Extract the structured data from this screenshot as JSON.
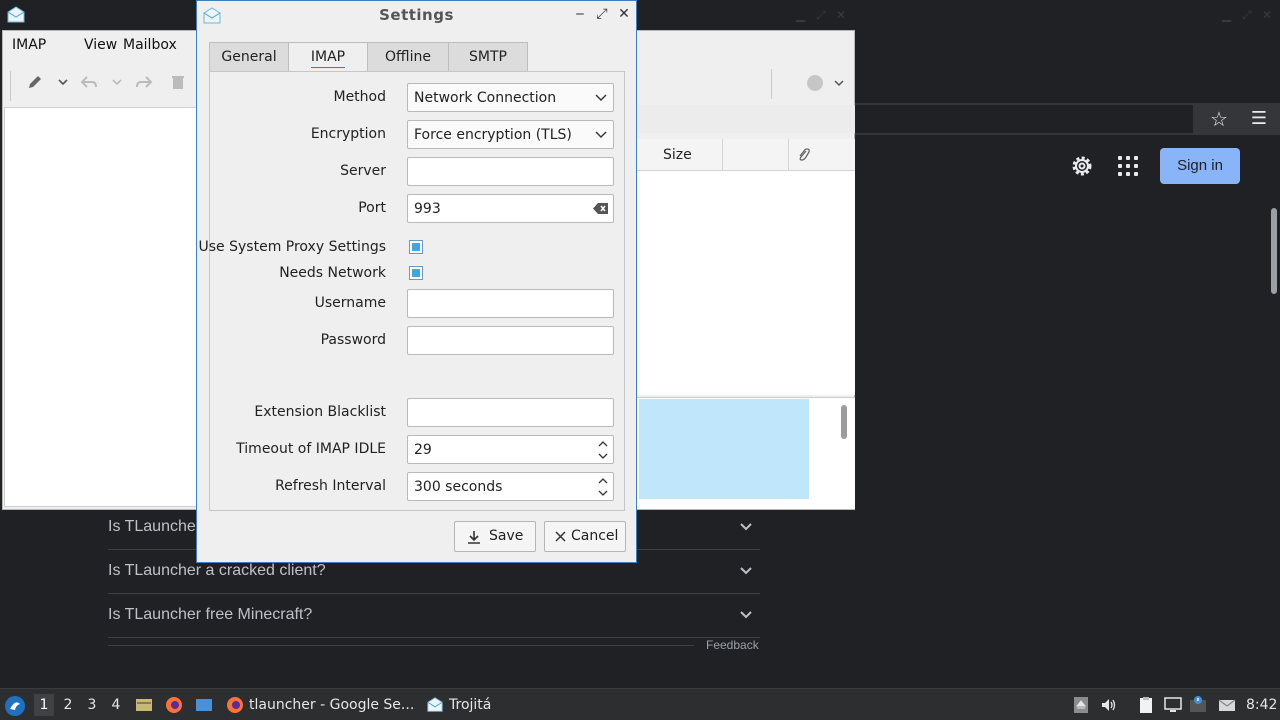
{
  "desktop": {
    "faq": [
      {
        "question": "Is TLauncher"
      },
      {
        "question": "Is TLauncher a cracked client?"
      },
      {
        "question": "Is TLauncher free Minecraft?"
      }
    ],
    "feedback_label": "Feedback",
    "signin_label": "Sign in"
  },
  "mail_window": {
    "menu": [
      "IMAP",
      "View",
      "Mailbox"
    ],
    "columns": {
      "size": "Size"
    }
  },
  "dialog": {
    "title": "Settings",
    "tabs": [
      {
        "label": "General"
      },
      {
        "label": "IMAP"
      },
      {
        "label": "Offline"
      },
      {
        "label": "SMTP"
      }
    ],
    "active_tab": "IMAP",
    "fields": {
      "method": {
        "label": "Method",
        "value": "Network Connection"
      },
      "encryption": {
        "label": "Encryption",
        "value": "Force encryption (TLS)"
      },
      "server": {
        "label": "Server",
        "value": ""
      },
      "port": {
        "label": "Port",
        "value": "993"
      },
      "proxy": {
        "label": "Use System Proxy Settings",
        "checked": true
      },
      "needs_network": {
        "label": "Needs Network",
        "checked": true
      },
      "username": {
        "label": "Username",
        "value": ""
      },
      "password": {
        "label": "Password",
        "value": ""
      },
      "extension_blacklist": {
        "label": "Extension Blacklist",
        "value": ""
      },
      "timeout": {
        "label": "Timeout of IMAP IDLE",
        "value": "29"
      },
      "refresh": {
        "label": "Refresh Interval",
        "value": "300 seconds"
      }
    },
    "buttons": {
      "save": "Save",
      "cancel": "Cancel"
    }
  },
  "taskbar": {
    "workspaces": [
      "1",
      "2",
      "3",
      "4"
    ],
    "active_workspace": "1",
    "tasks": [
      {
        "label": "tlauncher - Google Se..."
      },
      {
        "label": "Trojitá"
      }
    ],
    "clock": "8:42"
  },
  "colors": {
    "accent": "#3d7fc1",
    "signin": "#8ab4f8",
    "desktop_bg": "#202124"
  }
}
